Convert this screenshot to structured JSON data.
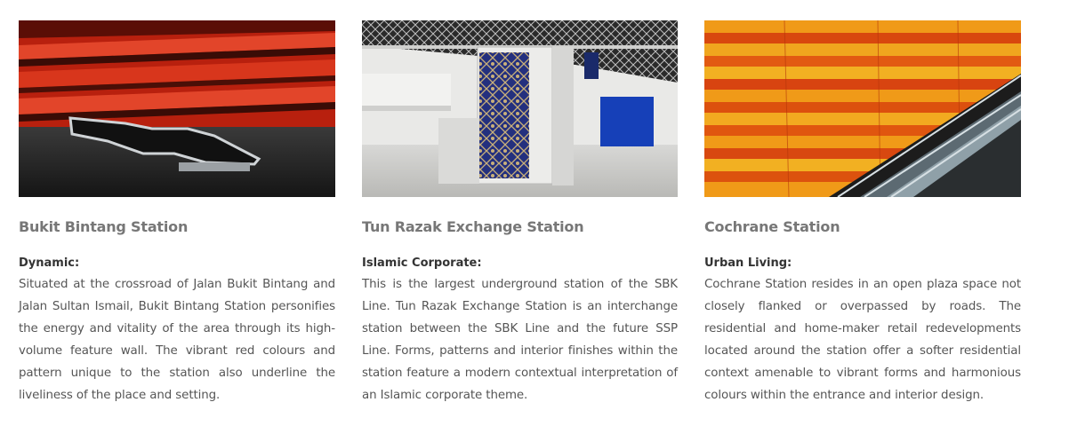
{
  "stations": [
    {
      "image_alt": "Bukit Bintang Station interior with red striped wall and bench",
      "title": "Bukit Bintang Station",
      "subtitle": "Dynamic:",
      "description": "Situated at the crossroad of Jalan Bukit Bintang and Jalan Sultan Ismail, Bukit Bintang Station personifies the energy and vitality of the area through its high-volume feature wall. The vibrant red colours and pattern unique to the station also underline the liveliness of the place and setting."
    },
    {
      "image_alt": "Tun Razak Exchange Station concourse with Islamic geometric pattern column",
      "title": "Tun Razak Exchange Station",
      "subtitle": "Islamic Corporate:",
      "description": "This is the largest underground station of the SBK Line. Tun Razak Exchange Station is an interchange station between the SBK Line and the future SSP Line. Forms, patterns and interior finishes within the station feature a modern contextual interpretation of an Islamic corporate theme."
    },
    {
      "image_alt": "Cochrane Station orange tiled wall with escalators",
      "title": "Cochrane Station",
      "subtitle": "Urban Living:",
      "description": "Cochrane Station resides in an open plaza space not closely flanked or overpassed by roads. The residential and home-maker retail redevelopments located around the station offer a softer residential context amenable to vibrant forms and harmonious colours within the entrance and interior design."
    }
  ],
  "colors": {
    "title": "#777777",
    "subtitle": "#333333",
    "text": "#555555",
    "red_wall": "#c62a12",
    "blue_pattern": "#2a3a8c",
    "orange_wall": "#e8761a"
  }
}
